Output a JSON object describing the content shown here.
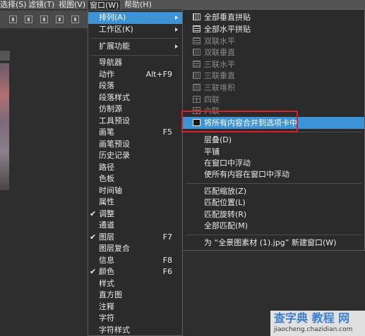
{
  "menubar": {
    "items": [
      {
        "label": "选择(S)"
      },
      {
        "label": "滤镜(T)"
      },
      {
        "label": "视图(V)"
      },
      {
        "label": "窗口(W)"
      },
      {
        "label": "帮助(H)"
      }
    ]
  },
  "window_menu": {
    "items": [
      {
        "label": "排列(A)",
        "submenu": true,
        "highlighted": true
      },
      {
        "label": "工作区(K)",
        "submenu": true
      },
      {
        "label": "扩展功能",
        "submenu": true
      },
      {
        "label": "导航器"
      },
      {
        "label": "动作",
        "shortcut": "Alt+F9"
      },
      {
        "label": "段落"
      },
      {
        "label": "段落样式"
      },
      {
        "label": "仿制源"
      },
      {
        "label": "工具预设"
      },
      {
        "label": "画笔",
        "shortcut": "F5"
      },
      {
        "label": "画笔预设"
      },
      {
        "label": "历史记录"
      },
      {
        "label": "路径"
      },
      {
        "label": "色板"
      },
      {
        "label": "时间轴"
      },
      {
        "label": "属性"
      },
      {
        "label": "调整",
        "checked": true
      },
      {
        "label": "通道"
      },
      {
        "label": "图层",
        "shortcut": "F7",
        "checked": true
      },
      {
        "label": "图层复合"
      },
      {
        "label": "信息",
        "shortcut": "F8"
      },
      {
        "label": "颜色",
        "shortcut": "F6",
        "checked": true
      },
      {
        "label": "样式"
      },
      {
        "label": "直方图"
      },
      {
        "label": "注释"
      },
      {
        "label": "字符"
      },
      {
        "label": "字符样式"
      }
    ]
  },
  "arrange_submenu": {
    "items": [
      {
        "label": "全部垂直拼贴",
        "icon": "vertical-tile-icon",
        "disabled": false
      },
      {
        "label": "全部水平拼贴",
        "icon": "horizontal-tile-icon",
        "disabled": false
      },
      {
        "label": "双联水平",
        "icon": "two-up-horizontal-icon",
        "disabled": true
      },
      {
        "label": "双联垂直",
        "icon": "two-up-vertical-icon",
        "disabled": true
      },
      {
        "label": "三联水平",
        "icon": "three-up-horizontal-icon",
        "disabled": true
      },
      {
        "label": "三联垂直",
        "icon": "three-up-vertical-icon",
        "disabled": true
      },
      {
        "label": "三联堆积",
        "icon": "three-up-stacked-icon",
        "disabled": true
      },
      {
        "label": "四联",
        "icon": "four-up-icon",
        "disabled": true
      },
      {
        "label": "六联",
        "icon": "six-up-icon",
        "disabled": true
      },
      {
        "label": "将所有内容合并到选项卡中",
        "icon": "consolidate-tabs-icon",
        "highlighted": true
      },
      {
        "label": "层叠(D)"
      },
      {
        "label": "平铺"
      },
      {
        "label": "在窗口中浮动"
      },
      {
        "label": "使所有内容在窗口中浮动"
      },
      {
        "label": "匹配缩放(Z)"
      },
      {
        "label": "匹配位置(L)"
      },
      {
        "label": "匹配旋转(R)"
      },
      {
        "label": "全部匹配(M)"
      },
      {
        "label": "为 “全景图素材 (1).jpg” 新建窗口(W)"
      }
    ]
  },
  "watermark": {
    "line1": "查字典 教程 网",
    "line2": "jiaocheng.chazidian.com"
  },
  "colors": {
    "highlight": "#3d93d6",
    "annotation_box": "#d8202a",
    "menu_bg": "#2b2b2b"
  }
}
